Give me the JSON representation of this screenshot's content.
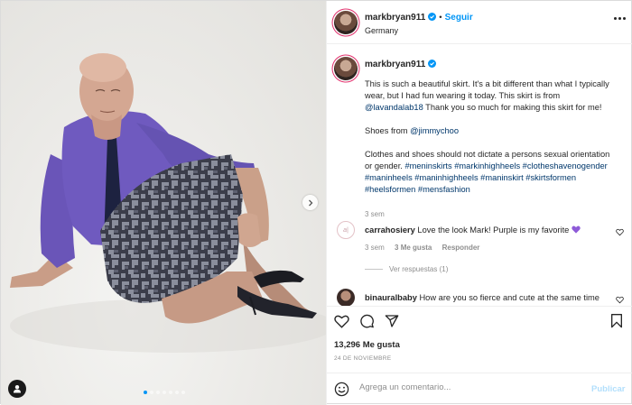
{
  "post": {
    "username": "markbryan911",
    "verified": true,
    "follow_label": "Seguir",
    "bullet": "•",
    "location": "Germany",
    "carousel_total": 7,
    "carousel_active": 1
  },
  "caption": {
    "username": "markbryan911",
    "text_1a": "This is such a beautiful skirt. It's a bit different than what I typically wear, but I had fun wearing it today. This skirt is from ",
    "mention_1": "@lavandalab18",
    "text_1b": " Thank you so much for making this skirt for me!",
    "text_2a": "Shoes from ",
    "mention_2": "@jimmychoo",
    "text_3": "Clothes and shoes should not dictate a persons sexual orientation or gender.",
    "hashtags": "#meninskirts #markinhighheels #clotheshavenogender #maninheels #maninhighheels #maninskirt #skirtsformen #heelsformen #mensfashion",
    "time": "3 sem"
  },
  "comments": [
    {
      "username": "carrahosiery",
      "avatar_text": "a|",
      "text": "Love the look Mark! Purple is my favorite",
      "emoji_color": "#8e5bd8",
      "time": "3 sem",
      "likes": "3 Me gusta",
      "reply": "Responder",
      "view_replies": "Ver respuestas (1)"
    },
    {
      "username": "binauralbaby",
      "text": "How are you so fierce and cute at the same time"
    }
  ],
  "actions": {
    "likes": "13,296 Me gusta",
    "date": "24 DE NOVIEMBRE"
  },
  "add_comment": {
    "placeholder": "Agrega un comentario...",
    "publish_label": "Publicar"
  },
  "colors": {
    "accent": "#0095f6",
    "link": "#00376b",
    "muted": "#8e8e8e",
    "shirt": "#6a55b8"
  },
  "icons": [
    "verified-badge-icon",
    "more-options-icon",
    "heart-icon",
    "comment-icon",
    "share-icon",
    "bookmark-icon",
    "emoji-icon",
    "next-arrow-icon",
    "user-tag-icon"
  ]
}
